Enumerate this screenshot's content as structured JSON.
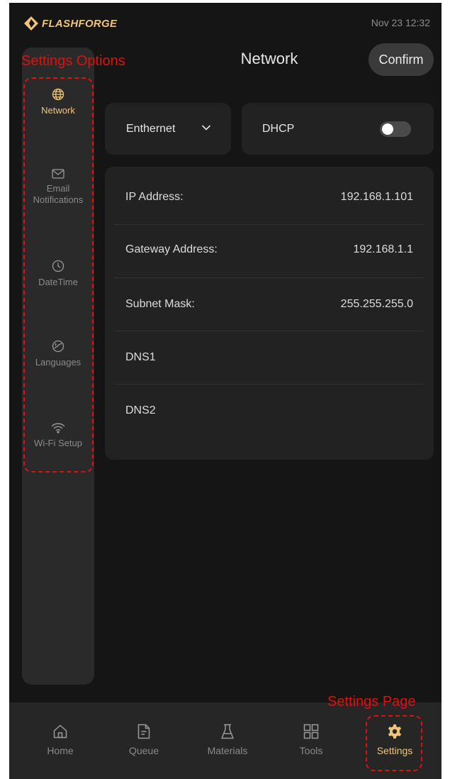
{
  "status_bar": {
    "brand": "FLASHFORGE",
    "datetime": "Nov 23  12:32"
  },
  "annotations": {
    "settings_options": "Settings Options",
    "settings_page": "Settings Page"
  },
  "header": {
    "title": "Network",
    "confirm_label": "Confirm"
  },
  "sidebar": {
    "items": [
      {
        "label": "Network",
        "icon": "globe-icon",
        "active": true
      },
      {
        "label": "Email Notifications",
        "icon": "envelope-icon",
        "active": false
      },
      {
        "label": "DateTime",
        "icon": "clock-icon",
        "active": false
      },
      {
        "label": "Languages",
        "icon": "languages-icon",
        "active": false
      },
      {
        "label": "Wi-Fi Setup",
        "icon": "wifi-icon",
        "active": false
      }
    ]
  },
  "connection": {
    "type_selected": "Enthernet",
    "dhcp_label": "DHCP",
    "dhcp_enabled": false
  },
  "network_info": {
    "rows": [
      {
        "label": "IP Address:",
        "value": "192.168.1.101"
      },
      {
        "label": "Gateway Address:",
        "value": "192.168.1.1"
      },
      {
        "label": "Subnet Mask:",
        "value": "255.255.255.0"
      },
      {
        "label": "DNS1",
        "value": ""
      },
      {
        "label": "DNS2",
        "value": ""
      }
    ]
  },
  "bottom_nav": {
    "items": [
      {
        "label": "Home",
        "icon": "home-icon",
        "active": false
      },
      {
        "label": "Queue",
        "icon": "document-icon",
        "active": false
      },
      {
        "label": "Materials",
        "icon": "flask-icon",
        "active": false
      },
      {
        "label": "Tools",
        "icon": "grid-icon",
        "active": false
      },
      {
        "label": "Settings",
        "icon": "gear-icon",
        "active": true
      }
    ]
  },
  "colors": {
    "background": "#151515",
    "panel": "#222222",
    "sidebar": "#2a2a2a",
    "accent": "#f0c57a",
    "annotation": "#e01010"
  }
}
